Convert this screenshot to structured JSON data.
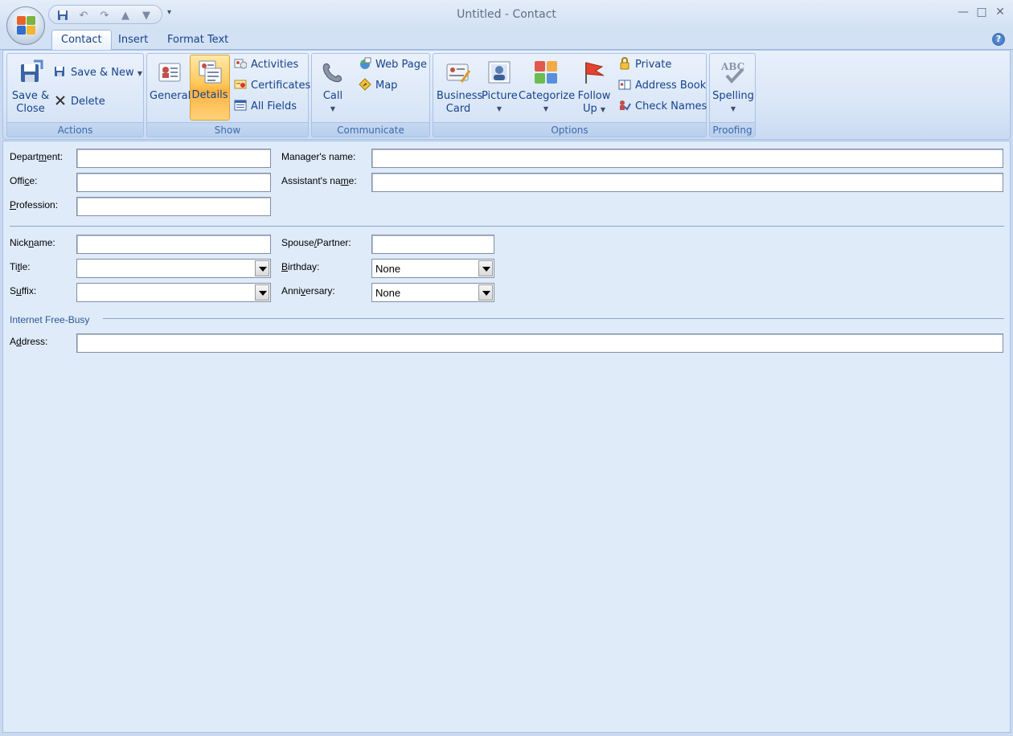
{
  "window": {
    "title_left": "Untitled",
    "title_sep": "-",
    "title_right": "Contact",
    "minimize": "—",
    "maximize": "□",
    "close": "✕"
  },
  "qat": {
    "save": "save-icon",
    "undo": "undo-icon",
    "redo": "redo-icon",
    "up": "previous-item-icon",
    "down": "next-item-icon",
    "customize": "▾"
  },
  "tabs": [
    {
      "label": "Contact",
      "active": true
    },
    {
      "label": "Insert",
      "active": false
    },
    {
      "label": "Format Text",
      "active": false
    }
  ],
  "help": "?",
  "ribbon": {
    "actions": {
      "label": "Actions",
      "save_close_1": "Save &",
      "save_close_2": "Close",
      "save_new": "Save & New",
      "delete": "Delete"
    },
    "show": {
      "label": "Show",
      "general": "General",
      "details": "Details",
      "activities": "Activities",
      "certificates": "Certificates",
      "all_fields": "All Fields"
    },
    "communicate": {
      "label": "Communicate",
      "call": "Call",
      "web_page": "Web Page",
      "map": "Map"
    },
    "options": {
      "label": "Options",
      "business_card_1": "Business",
      "business_card_2": "Card",
      "picture": "Picture",
      "categorize": "Categorize",
      "follow_up_1": "Follow",
      "follow_up_2": "Up",
      "private": "Private",
      "address_book": "Address Book",
      "check_names": "Check Names"
    },
    "proofing": {
      "label": "Proofing",
      "spelling": "Spelling",
      "abc": "ABC"
    }
  },
  "form": {
    "department": {
      "pre": "Depart",
      "key": "m",
      "post": "ent:",
      "value": ""
    },
    "office": {
      "pre": "Offi",
      "key": "c",
      "post": "e:",
      "value": ""
    },
    "profession": {
      "pre": "",
      "key": "P",
      "post": "rofession:",
      "value": ""
    },
    "manager": {
      "pre": "Mana",
      "key": "g",
      "post": "er's name:",
      "value": ""
    },
    "assistant": {
      "pre": "Assistant's na",
      "key": "m",
      "post": "e:",
      "value": ""
    },
    "nickname": {
      "pre": "Nick",
      "key": "n",
      "post": "ame:",
      "value": ""
    },
    "title": {
      "pre": "Ti",
      "key": "t",
      "post": "le:",
      "value": ""
    },
    "suffix": {
      "pre": "S",
      "key": "u",
      "post": "ffix:",
      "value": ""
    },
    "spouse": {
      "pre": "Spouse",
      "key": "/",
      "post": "Partner:",
      "value": ""
    },
    "birthday": {
      "pre": "",
      "key": "B",
      "post": "irthday:",
      "value": "None"
    },
    "anniversary": {
      "pre": "Anni",
      "key": "v",
      "post": "ersary:",
      "value": "None"
    },
    "free_busy_section": "Internet Free-Busy",
    "address": {
      "pre": "A",
      "key": "d",
      "post": "dress:",
      "value": ""
    }
  }
}
